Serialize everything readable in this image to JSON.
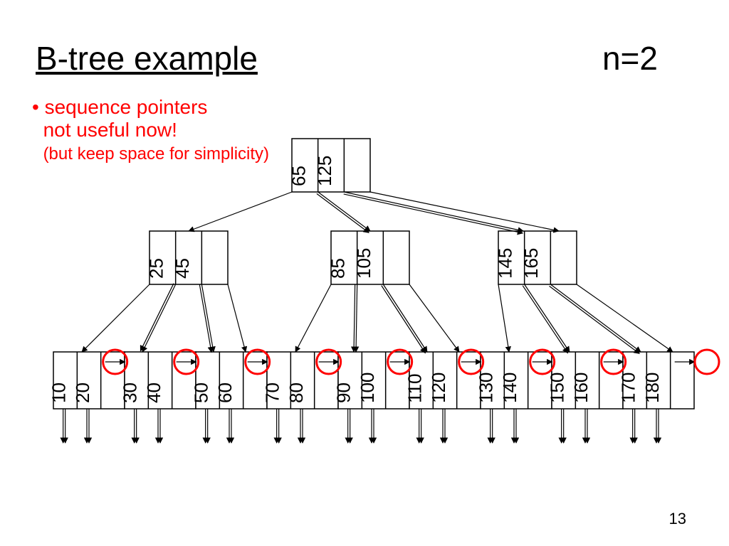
{
  "title": "B-tree example",
  "n_label": "n=2",
  "note": {
    "bullet": "• sequence pointers",
    "line2": "not useful now!",
    "line3": "(but keep space for simplicity)"
  },
  "page_number": "13",
  "root": {
    "keys": [
      "65",
      "125"
    ]
  },
  "mid": [
    {
      "keys": [
        "25",
        "45"
      ]
    },
    {
      "keys": [
        "85",
        "105"
      ]
    },
    {
      "keys": [
        "145",
        "165"
      ]
    }
  ],
  "leaves": [
    {
      "keys": [
        "10",
        "20"
      ]
    },
    {
      "keys": [
        "30",
        "40"
      ]
    },
    {
      "keys": [
        "50",
        "60"
      ]
    },
    {
      "keys": [
        "70",
        "80"
      ]
    },
    {
      "keys": [
        "90",
        "100"
      ]
    },
    {
      "keys": [
        "110",
        "120"
      ]
    },
    {
      "keys": [
        "130",
        "140"
      ]
    },
    {
      "keys": [
        "150",
        "160"
      ]
    },
    {
      "keys": [
        "170",
        "180"
      ]
    }
  ]
}
